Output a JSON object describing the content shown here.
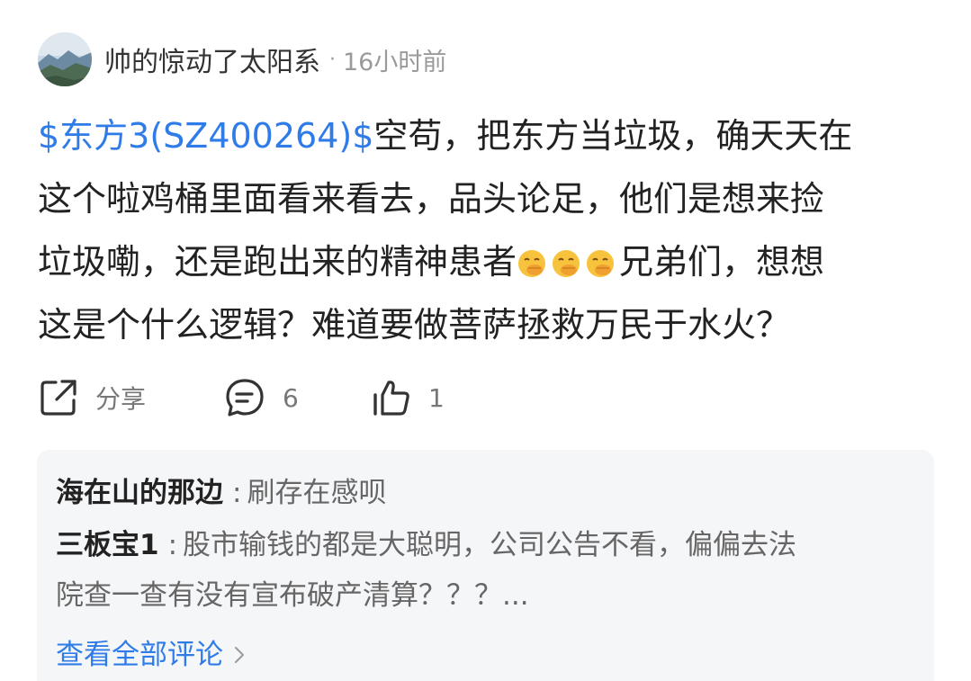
{
  "post": {
    "author": "帅的惊动了太阳系",
    "dot": "·",
    "time": "16小时前",
    "lines": [
      {
        "link": "$东方3(SZ400264)$",
        "text": "空苟，把东方当垃圾，确天天在"
      },
      {
        "text": "这个啦鸡桶里面看来看去，品头论足，他们是想来捡"
      },
      {
        "text": "垃圾嘞，还是跑出来的精神患者",
        "after": "兄弟们，想想"
      },
      {
        "text": "这是个什么逻辑？难道要做菩萨拯救万民于水火？"
      }
    ],
    "emoji_icon": "hand-over-mouth-emoji"
  },
  "actions": {
    "share_label": "分享",
    "comment_count": "6",
    "like_count": "1"
  },
  "comments": {
    "items": [
      {
        "name": "海在山的那边",
        "sep": ":",
        "text": "刷存在感呗"
      },
      {
        "name": "三板宝1",
        "sep": ":",
        "text": "股市输钱的都是大聪明，公司公告不看，偏偏去法",
        "text2": "院查一查有没有宣布破产清算？？？..."
      }
    ],
    "view_all_label": "查看全部评论"
  },
  "colors": {
    "link": "#2f7ce9",
    "comment_bg": "#f5f6f8"
  }
}
